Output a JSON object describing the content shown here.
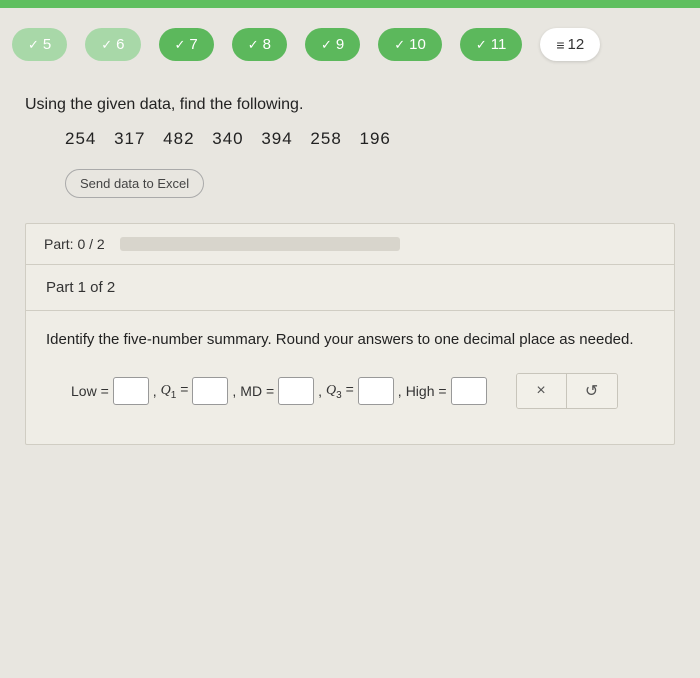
{
  "nav": {
    "items": [
      {
        "num": "5",
        "state": "light",
        "done": true
      },
      {
        "num": "6",
        "state": "light",
        "done": true
      },
      {
        "num": "7",
        "state": "done",
        "done": true
      },
      {
        "num": "8",
        "state": "done",
        "done": true
      },
      {
        "num": "9",
        "state": "done",
        "done": true
      },
      {
        "num": "10",
        "state": "done",
        "done": true
      },
      {
        "num": "11",
        "state": "done",
        "done": true
      },
      {
        "num": "12",
        "state": "current",
        "done": false
      }
    ]
  },
  "problem": {
    "prompt": "Using the given data, find the following.",
    "data_values": "254  317  482  340  394  258  196",
    "excel_button": "Send data to Excel"
  },
  "progress": {
    "label": "Part: 0 / 2"
  },
  "part": {
    "header": "Part 1 of 2",
    "instruction": "Identify the five-number summary. Round your answers to one decimal place as needed.",
    "labels": {
      "low": "Low =",
      "q1_q": "Q",
      "q1_sub": "1",
      "eq": " =",
      "md": "MD =",
      "q3_q": "Q",
      "q3_sub": "3",
      "high": "High ="
    },
    "comma": ","
  },
  "actions": {
    "clear": "×",
    "reset": "↺"
  }
}
